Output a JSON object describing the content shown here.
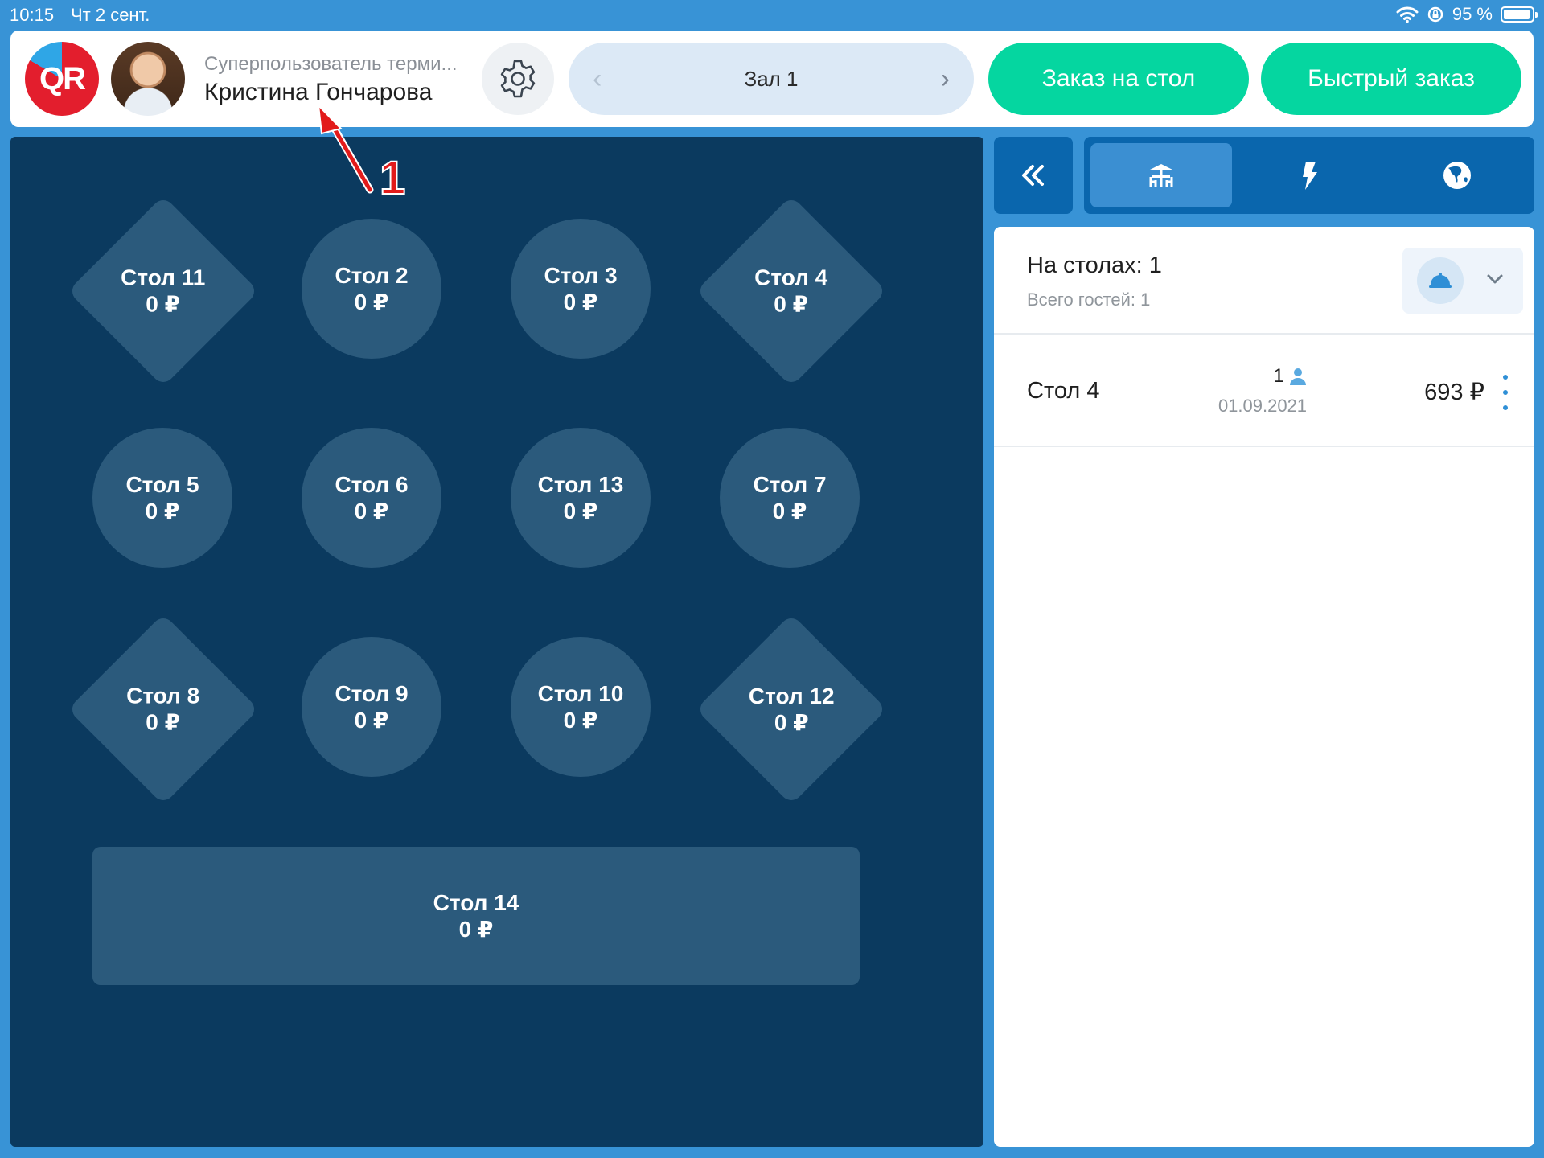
{
  "status_bar": {
    "time": "10:15",
    "date": "Чт 2 сент.",
    "battery": "95 %",
    "battery_level_percent": 95
  },
  "header": {
    "logo_text": "QR",
    "user_role": "Суперпользователь терми...",
    "user_name": "Кристина Гончарова",
    "hall_name": "Зал 1",
    "table_order_label": "Заказ на стол",
    "quick_order_label": "Быстрый заказ"
  },
  "annotation": {
    "marker": "1"
  },
  "floor": {
    "tables": [
      {
        "name": "Стол 11",
        "sum": "0 ₽",
        "shape": "diamond"
      },
      {
        "name": "Стол 2",
        "sum": "0 ₽",
        "shape": "circle"
      },
      {
        "name": "Стол 3",
        "sum": "0 ₽",
        "shape": "circle"
      },
      {
        "name": "Стол 4",
        "sum": "0 ₽",
        "shape": "diamond"
      },
      {
        "name": "Стол 5",
        "sum": "0 ₽",
        "shape": "circle"
      },
      {
        "name": "Стол 6",
        "sum": "0 ₽",
        "shape": "circle"
      },
      {
        "name": "Стол 13",
        "sum": "0 ₽",
        "shape": "circle"
      },
      {
        "name": "Стол 7",
        "sum": "0 ₽",
        "shape": "circle"
      },
      {
        "name": "Стол 8",
        "sum": "0 ₽",
        "shape": "diamond"
      },
      {
        "name": "Стол 9",
        "sum": "0 ₽",
        "shape": "circle"
      },
      {
        "name": "Стол 10",
        "sum": "0 ₽",
        "shape": "circle"
      },
      {
        "name": "Стол 12",
        "sum": "0 ₽",
        "shape": "diamond"
      },
      {
        "name": "Стол 14",
        "sum": "0 ₽",
        "shape": "rect"
      }
    ]
  },
  "panel": {
    "tabs": [
      {
        "icon": "table-icon",
        "active": true
      },
      {
        "icon": "lightning-icon",
        "active": false
      },
      {
        "icon": "globe-icon",
        "active": false
      }
    ],
    "summary_title": "На столах: 1",
    "summary_sub": "Всего гостей: 1",
    "orders": [
      {
        "table": "Стол 4",
        "guests": "1",
        "date": "01.09.2021",
        "sum": "693 ₽"
      }
    ]
  },
  "colors": {
    "background": "#3893d6",
    "floor": "#0b3a5f",
    "table": "#2b5a7c",
    "accent_green": "#05d6a0",
    "panel_blue": "#0a66ad",
    "annotation_red": "#e21b1b"
  }
}
